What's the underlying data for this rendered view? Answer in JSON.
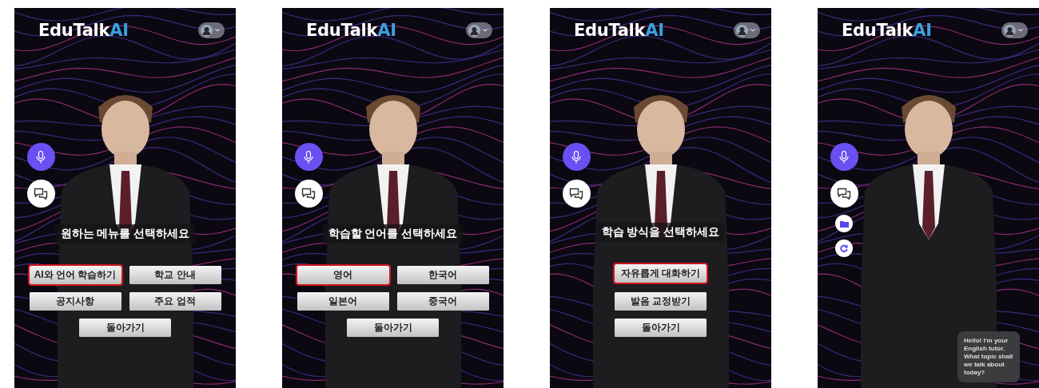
{
  "screens": [
    {
      "logo": {
        "text": "EduTalk",
        "accent": "AI"
      },
      "side_buttons": [
        {
          "kind": "mic"
        },
        {
          "kind": "chat"
        }
      ],
      "kind": "grid",
      "prompt": "원하는 메뉴를 선택하세요",
      "options": [
        {
          "label": "AI와 언어 학습하기",
          "selected": true
        },
        {
          "label": "학교 안내",
          "selected": false
        },
        {
          "label": "공지사항",
          "selected": false
        },
        {
          "label": "주요 업적",
          "selected": false
        }
      ],
      "back_button": "돌아가기"
    },
    {
      "logo": {
        "text": "EduTalk",
        "accent": "AI"
      },
      "side_buttons": [
        {
          "kind": "mic"
        },
        {
          "kind": "chat"
        }
      ],
      "kind": "grid",
      "prompt": "학습할 언어를 선택하세요",
      "options": [
        {
          "label": "영어",
          "selected": true
        },
        {
          "label": "한국어",
          "selected": false
        },
        {
          "label": "일본어",
          "selected": false
        },
        {
          "label": "중국어",
          "selected": false
        }
      ],
      "back_button": "돌아가기"
    },
    {
      "logo": {
        "text": "EduTalk",
        "accent": "AI"
      },
      "side_buttons": [
        {
          "kind": "mic"
        },
        {
          "kind": "chat"
        }
      ],
      "kind": "list",
      "prompt": "학습 방식을 선택하세요",
      "options": [
        {
          "label": "자유롭게 대화하기",
          "selected": true
        },
        {
          "label": "발음 교정받기",
          "selected": false
        }
      ],
      "back_button": "돌아가기"
    },
    {
      "logo": {
        "text": "EduTalk",
        "accent": "AI"
      },
      "side_buttons": [
        {
          "kind": "mic"
        },
        {
          "kind": "chat"
        },
        {
          "kind": "folder"
        },
        {
          "kind": "refresh"
        }
      ],
      "kind": "chat",
      "chat_bubble": "Hello! I'm your English tutor. What topic shall we talk about today?"
    }
  ]
}
